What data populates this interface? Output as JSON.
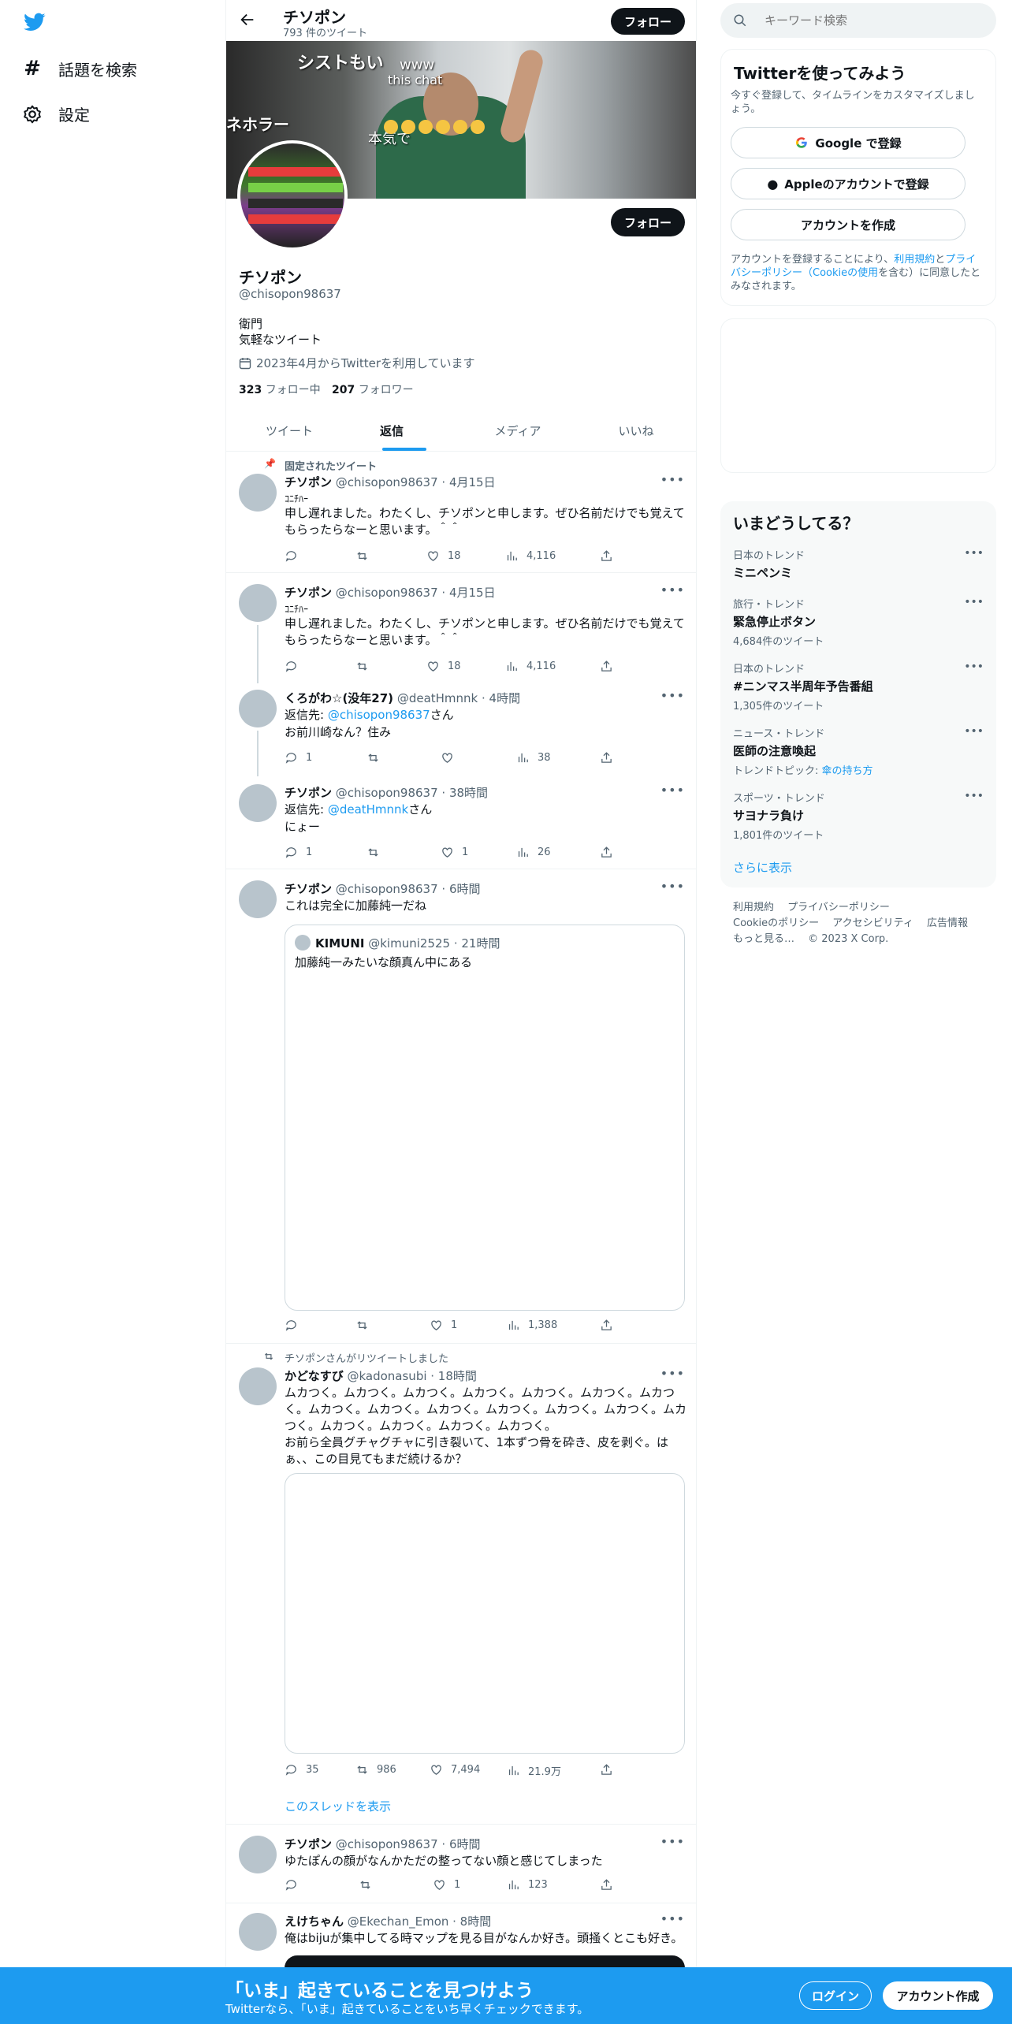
{
  "nav": {
    "items": [
      {
        "label": "話題を検索"
      },
      {
        "label": "設定"
      }
    ]
  },
  "header": {
    "title": "チソポン",
    "tweet_count": "793 件のツイート",
    "follow": "フォロー"
  },
  "profile": {
    "name": "チソポン",
    "handle": "@chisopon98637",
    "bio_line1": "衛門",
    "bio_line2": "気軽なツイート",
    "joined": "2023年4月からTwitterを利用しています",
    "following_count": "323",
    "following_label": "フォロー中",
    "followers_count": "207",
    "followers_label": "フォロワー",
    "follow": "フォロー"
  },
  "tabs": [
    {
      "label": "ツイート"
    },
    {
      "label": "返信"
    },
    {
      "label": "メディア"
    },
    {
      "label": "いいね"
    }
  ],
  "tweets": [
    {
      "pinned_label": "固定されたツイート",
      "name": "チソポン",
      "meta": "@chisopon98637 · 4月15日",
      "line0": "ｺﾆﾁﾊｰ",
      "text": "申し遅れました。わたくし、チソポンと申します。ぜひ名前だけでも覚えてもらったらなーと思います。＾＾",
      "replies": "",
      "retweets": "",
      "likes": "18",
      "views": "4,116"
    },
    {
      "name": "チソポン",
      "meta": "@chisopon98637 · 4月15日",
      "line0": "ｺﾆﾁﾊｰ",
      "text": "申し遅れました。わたくし、チソポンと申します。ぜひ名前だけでも覚えてもらったらなーと思います。＾＾",
      "replies": "",
      "retweets": "",
      "likes": "18",
      "views": "4,116"
    },
    {
      "name": "くろがわ☆(没年27)",
      "meta": "@deatHmnnk · 4時間",
      "reply_prefix": "返信先: ",
      "reply_to": "@chisopon98637",
      "reply_suffix": "さん",
      "text": "お前川崎なん？住み",
      "replies": "1",
      "retweets": "",
      "likes": "",
      "views": "38"
    },
    {
      "name": "チソポン",
      "meta": "@chisopon98637 · 38時間",
      "reply_prefix": "返信先: ",
      "reply_to": "@deatHmnnk",
      "reply_suffix": "さん",
      "text": "にょー",
      "replies": "1",
      "retweets": "",
      "likes": "1",
      "views": "26"
    },
    {
      "name": "チソポン",
      "meta": "@chisopon98637 · 6時間",
      "text": "これは完全に加藤純一だね",
      "quote_name": "KIMUNI",
      "quote_meta": "@kimuni2525 · 21時間",
      "quote_text": "加藤純一みたいな顔真ん中にある",
      "replies": "",
      "retweets": "",
      "likes": "1",
      "views": "1,388"
    },
    {
      "retweet_label": "チソポンさんがリツイートしました",
      "name": "かどなすび",
      "meta": "@kadonasubi · 18時間",
      "text": "ムカつく。ムカつく。ムカつく。ムカつく。ムカつく。ムカつく。ムカつく。ムカつく。ムカつく。ムカつく。ムカつく。ムカつく。ムカつく。ムカつく。ムカつく。ムカつく。ムカつく。ムカつく。",
      "text2": "お前ら全員グチャグチャに引き裂いて、1本ずつ骨を砕き、皮を剥ぐ。はぁ、、この目見てもまだ続けるか？",
      "replies": "35",
      "retweets": "986",
      "likes": "7,494",
      "views": "21.9万",
      "show_thread": "このスレッドを表示"
    },
    {
      "name": "チソポン",
      "meta": "@chisopon98637 · 6時間",
      "text": "ゆたぽんの顔がなんかただの整ってない顔と感じてしまった",
      "replies": "",
      "retweets": "",
      "likes": "1",
      "views": "123"
    },
    {
      "name": "えけちゃん",
      "meta": "@Ekechan_Emon · 8時間",
      "text": "俺はbijuが集中してる時マップを見る目がなんか好き。頭掻くとこも好き。"
    }
  ],
  "search": {
    "placeholder": "キーワード検索"
  },
  "signup": {
    "title": "Twitterを使ってみよう",
    "subtitle": "今すぐ登録して、タイムラインをカスタマイズしましょう。",
    "google": "Google で登録",
    "apple": "Appleのアカウントで登録",
    "create": "アカウントを作成",
    "legal_prefix": "アカウントを登録することにより、",
    "legal_terms": "利用規約",
    "legal_and": "と",
    "legal_privacy": "プライバシーポリシー（Cookieの使用",
    "legal_suffix": "を含む）に同意したとみなされます。"
  },
  "trends": {
    "title": "いまどうしてる？",
    "items": [
      {
        "category": "日本のトレンド",
        "name": "ミニペンミ",
        "count": ""
      },
      {
        "category": "旅行・トレンド",
        "name": "緊急停止ボタン",
        "count": "4,684件のツイート"
      },
      {
        "category": "日本のトレンド",
        "name": "#ニンマス半周年予告番組",
        "count": "1,305件のツイート"
      },
      {
        "category": "ニュース・トレンド",
        "name": "医師の注意喚起",
        "count": "",
        "topic_prefix": "トレンドトピック: ",
        "topic": "傘の持ち方"
      },
      {
        "category": "スポーツ・トレンド",
        "name": "サヨナラ負け",
        "count": "1,801件のツイート"
      }
    ],
    "show_more": "さらに表示"
  },
  "footer": {
    "terms": "利用規約",
    "privacy": "プライバシーポリシー",
    "cookie": "Cookieのポリシー",
    "accessibility": "アクセシビリティ",
    "ads": "広告情報",
    "more": "もっと見る…",
    "copyright": "© 2023 X Corp."
  },
  "bottom": {
    "title": "「いま」起きていることを見つけよう",
    "subtitle": "Twitterなら、「いま」起きていることをいち早くチェックできます。",
    "login": "ログイン",
    "signup": "アカウント作成"
  },
  "banner_overlay": {
    "t1": "シストもい",
    "t2": "www",
    "t3": "this chat",
    "t4": "ネホラー",
    "t5": "本気で"
  }
}
